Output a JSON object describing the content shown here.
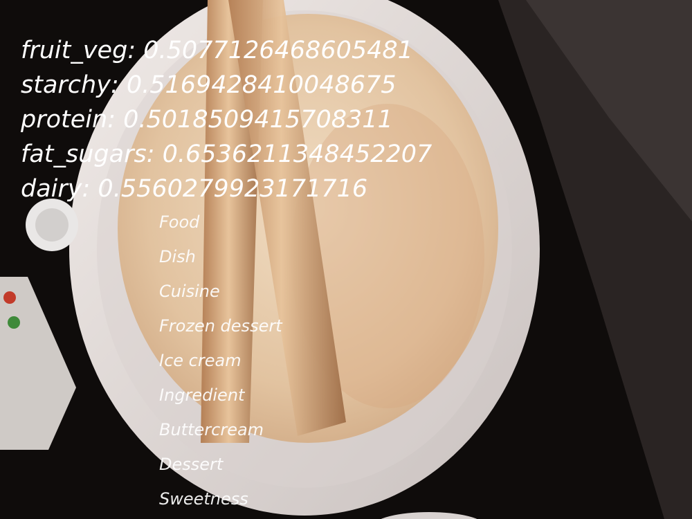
{
  "scores": [
    {
      "label": "fruit_veg",
      "value": "0.5077126468605481"
    },
    {
      "label": "starchy",
      "value": "0.5169428410048675"
    },
    {
      "label": "protein",
      "value": "0.5018509415708311"
    },
    {
      "label": "fat_sugars",
      "value": "0.6536211348452207"
    },
    {
      "label": "dairy",
      "value": "0.5560279923171716"
    }
  ],
  "labels": [
    "Food",
    "Dish",
    "Cuisine",
    "Frozen dessert",
    "Ice cream",
    "Ingredient",
    "Buttercream",
    "Dessert",
    "Sweetness"
  ],
  "colors": {
    "text": "#ffffff",
    "plate": "#e8e2df",
    "crepe": "#e7c9a6",
    "background": "#0f0c0b"
  }
}
